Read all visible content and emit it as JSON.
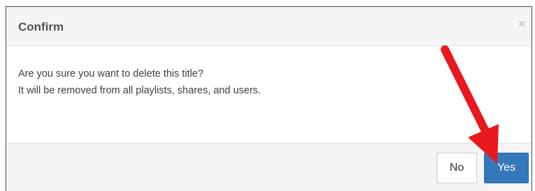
{
  "dialog": {
    "title": "Confirm",
    "close_glyph": "×",
    "message_line1": "Are you sure you want to delete this title?",
    "message_line2": "It will be removed from all playlists, shares, and users.",
    "no_label": "No",
    "yes_label": "Yes"
  },
  "annotation": {
    "arrow_color": "#e8191d",
    "points_to": "yes-button"
  },
  "colors": {
    "primary_button": "#3478bb",
    "header_background": "#f5f5f5"
  }
}
